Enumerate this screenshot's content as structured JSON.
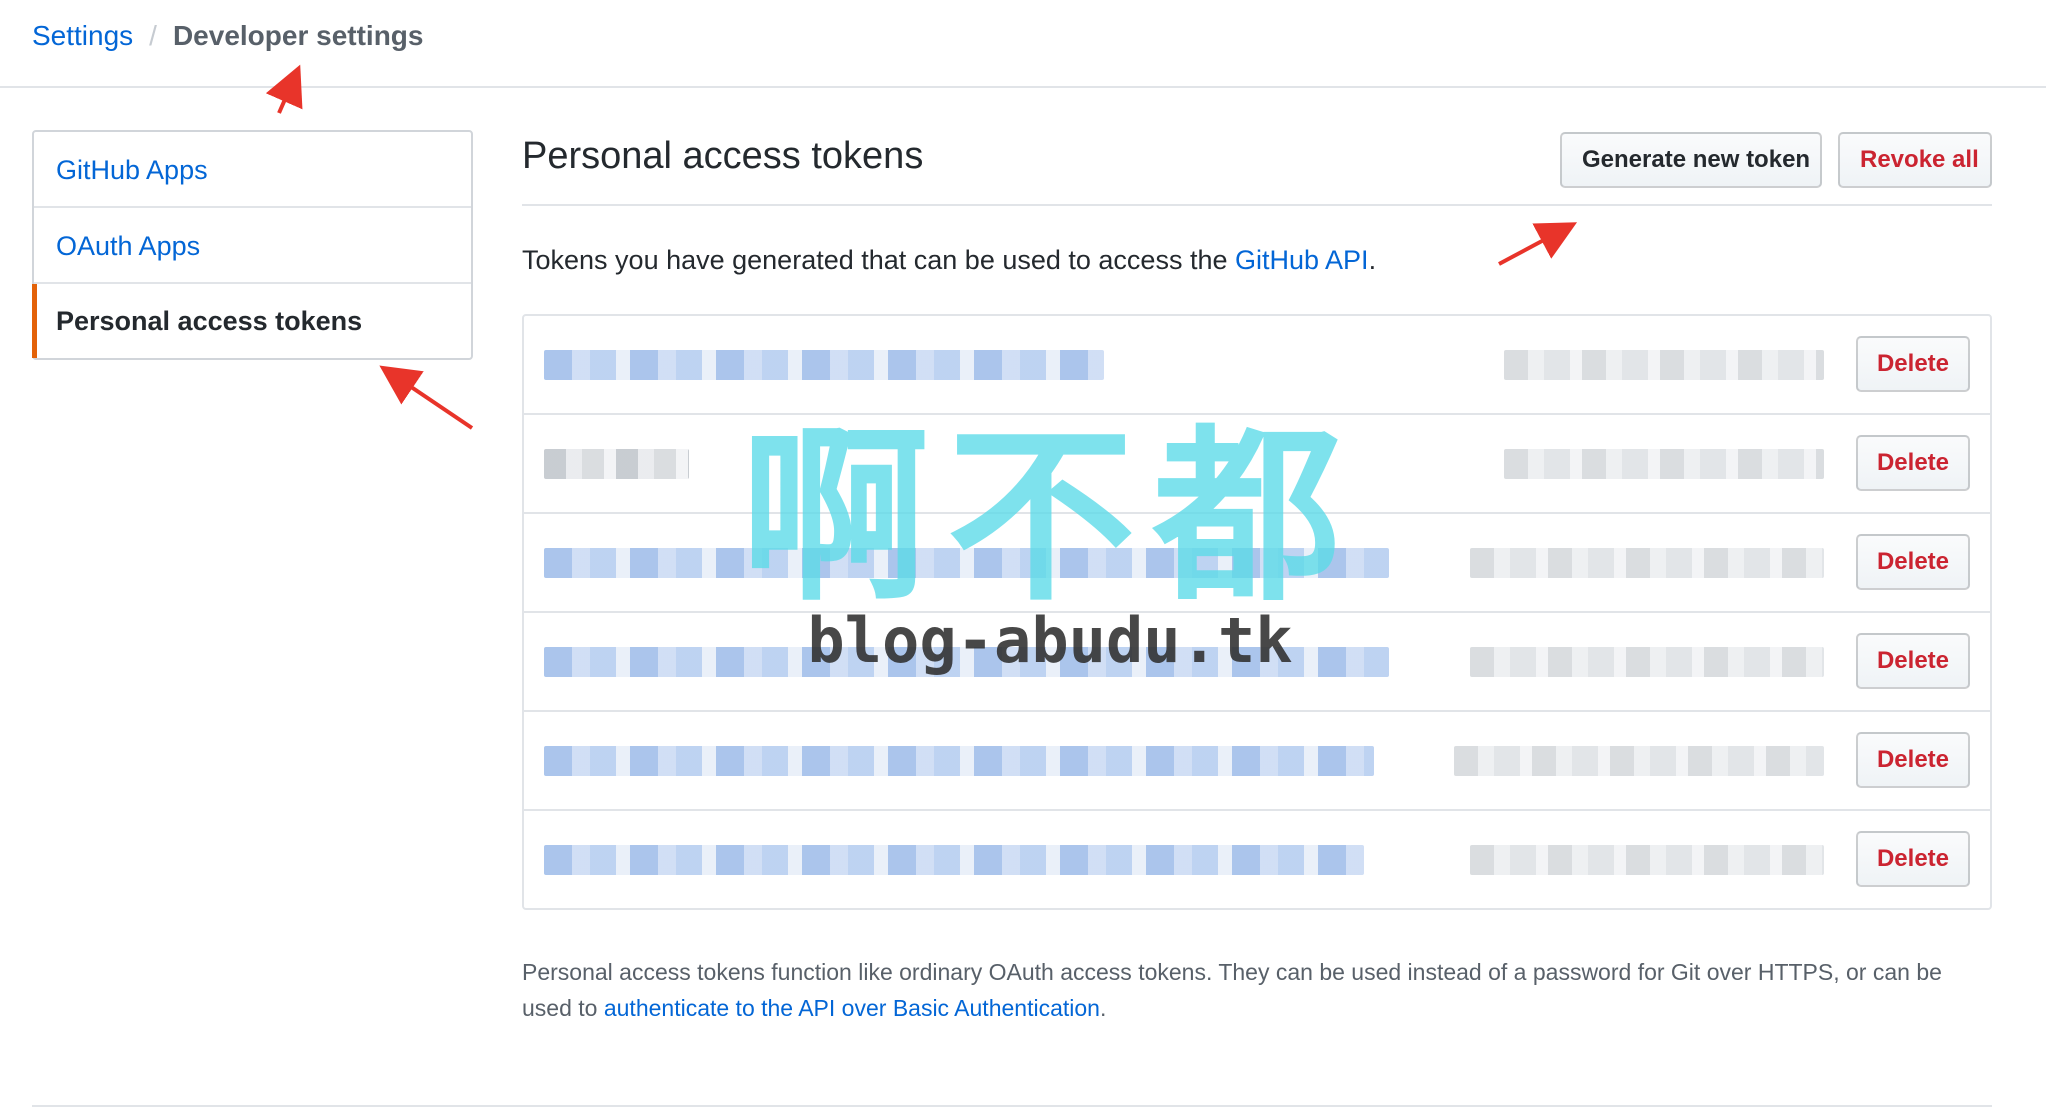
{
  "breadcrumb": {
    "settings_link": "Settings",
    "separator": "/",
    "current": "Developer settings"
  },
  "sidebar": {
    "items": [
      {
        "label": "GitHub Apps",
        "selected": false
      },
      {
        "label": "OAuth Apps",
        "selected": false
      },
      {
        "label": "Personal access tokens",
        "selected": true
      }
    ]
  },
  "main": {
    "title": "Personal access tokens",
    "generate_button": "Generate new token",
    "revoke_button": "Revoke all",
    "intro_text": "Tokens you have generated that can be used to access the ",
    "intro_link": "GitHub API",
    "intro_end": ".",
    "delete_label": "Delete",
    "tokens": [
      {
        "name": "",
        "scopes": "",
        "blurred": true
      },
      {
        "name": "",
        "scopes": "",
        "blurred": true
      },
      {
        "name": "",
        "scopes": "",
        "blurred": true
      },
      {
        "name": "",
        "scopes": "",
        "blurred": true
      },
      {
        "name": "",
        "scopes": "",
        "blurred": true
      },
      {
        "name": "",
        "scopes": "",
        "blurred": true
      }
    ],
    "note_text": "Personal access tokens function like ordinary OAuth access tokens. They can be used instead of a password for Git over HTTPS, or can be used to ",
    "note_link": "authenticate to the API over Basic Authentication",
    "note_end": "."
  },
  "watermark": {
    "title": "啊不都",
    "url": "blog-abudu.tk"
  },
  "colors": {
    "link": "#0366d6",
    "danger": "#cb2431",
    "selected_marker": "#e36209",
    "annotation_arrow": "#e8342a",
    "watermark": "#5bdbe8"
  }
}
